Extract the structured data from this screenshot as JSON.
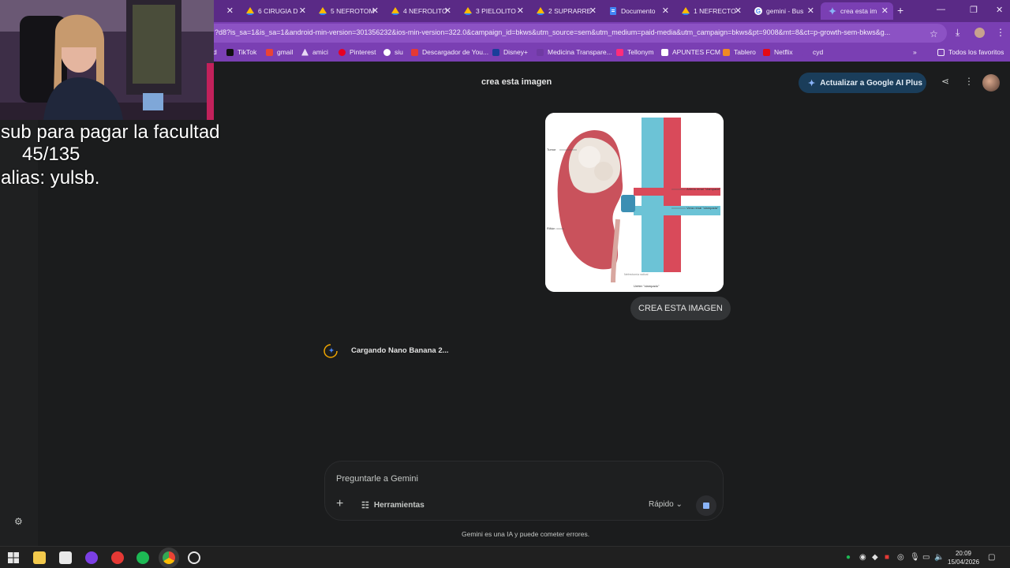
{
  "browser": {
    "tabs": [
      {
        "label": "6 CIRUGIA D",
        "icon": "drive-icon"
      },
      {
        "label": "5 NEFROTOM",
        "icon": "drive-icon"
      },
      {
        "label": "4 NEFROLITO",
        "icon": "drive-icon"
      },
      {
        "label": "3 PIELOLITO",
        "icon": "drive-icon"
      },
      {
        "label": "2 SUPRARRE",
        "icon": "drive-icon"
      },
      {
        "label": "Documento",
        "icon": "docs-icon"
      },
      {
        "label": "1 NEFRECTO",
        "icon": "drive-icon"
      },
      {
        "label": "gemini - Bus",
        "icon": "google-icon"
      },
      {
        "label": "crea esta im",
        "icon": "gemini-icon",
        "active": true
      }
    ],
    "url": "?d8?is_sa=1&is_sa=1&android-min-version=301356232&ios-min-version=322.0&campaign_id=bkws&utm_source=sem&utm_medium=paid-media&utm_campaign=bkws&pt=9008&mt=8&ct=p-growth-sem-bkws&g...",
    "bookmarks": [
      "d",
      "TikTok",
      "gmail",
      "amici",
      "Pinterest",
      "siu",
      "Descargador de You...",
      "Disney+",
      "Medicina Transpare...",
      "Tellonym",
      "APUNTES FCM",
      "Tablero",
      "Netflix",
      "cyd"
    ],
    "all_bookmarks": "Todos los favoritos"
  },
  "overlay": {
    "line1": "sub para pagar la facultad",
    "line2": "45/135",
    "line3": "alias: yulsb."
  },
  "gemini": {
    "chat_title": "crea esta imagen",
    "upgrade_label": "Actualizar a Google AI Plus",
    "user_message": "CREA ESTA IMAGEN",
    "loading_text": "Cargando Nano Banana 2...",
    "input_placeholder": "Preguntarle a Gemini",
    "tools_label": "Herramientas",
    "mode_label": "Rápido",
    "disclaimer": "Gemini es una IA y puede cometer errores."
  },
  "image_labels": {
    "tumor": "Tumor",
    "kidney": "Riñón",
    "artery": "Arteria renal \"clampada\"",
    "vein": "Vena renal \"clampada\"",
    "ureter": "Uréter \"clampado\"",
    "credit": "Nefrectomía radical"
  },
  "taskbar": {
    "time": "20:09",
    "date": "15/04/2026"
  },
  "colors": {
    "browser_chrome": "#7a3fb3",
    "tab_strip": "#5a2a86",
    "page_bg": "#1b1c1d",
    "accent_blue": "#8ab4f8"
  }
}
